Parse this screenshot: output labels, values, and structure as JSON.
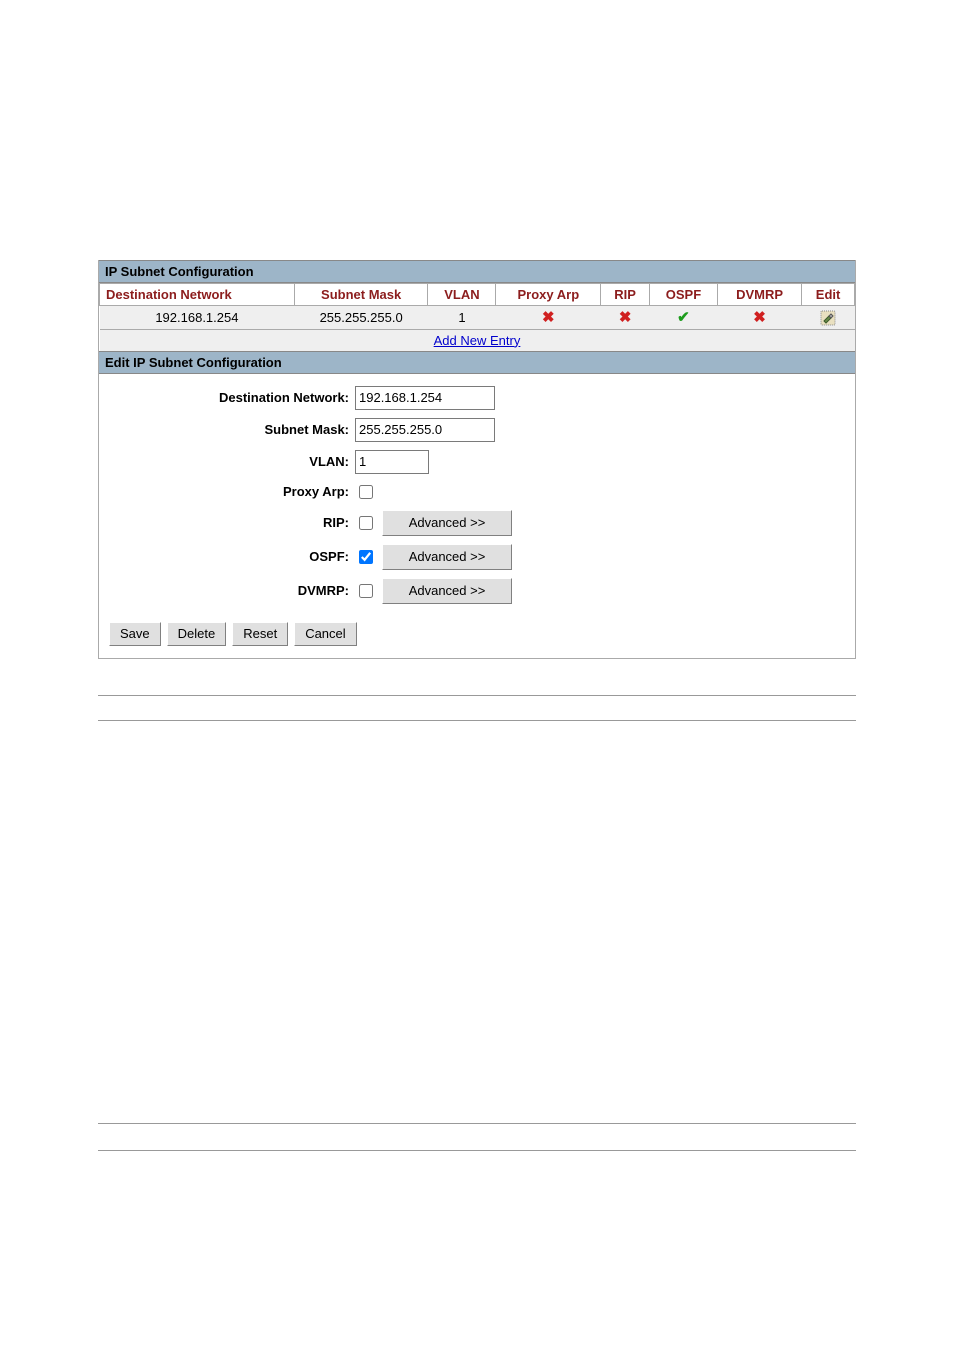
{
  "headers": {
    "main": "IP Subnet Configuration",
    "edit": "Edit IP Subnet Configuration"
  },
  "table": {
    "columns": {
      "dest": "Destination Network",
      "mask": "Subnet Mask",
      "vlan": "VLAN",
      "proxy": "Proxy Arp",
      "rip": "RIP",
      "ospf": "OSPF",
      "dvmrp": "DVMRP",
      "edit": "Edit"
    },
    "row": {
      "dest": "192.168.1.254",
      "mask": "255.255.255.0",
      "vlan": "1",
      "proxy": false,
      "rip": false,
      "ospf": true,
      "dvmrp": false
    },
    "add_link": "Add New Entry"
  },
  "form": {
    "labels": {
      "dest": "Destination Network:",
      "mask": "Subnet Mask:",
      "vlan": "VLAN:",
      "proxy": "Proxy Arp:",
      "rip": "RIP:",
      "ospf": "OSPF:",
      "dvmrp": "DVMRP:"
    },
    "values": {
      "dest": "192.168.1.254",
      "mask": "255.255.255.0",
      "vlan": "1",
      "proxy": false,
      "rip": false,
      "ospf": true,
      "dvmrp": false
    },
    "advanced_label": "Advanced >>",
    "buttons": {
      "save": "Save",
      "delete": "Delete",
      "reset": "Reset",
      "cancel": "Cancel"
    }
  }
}
